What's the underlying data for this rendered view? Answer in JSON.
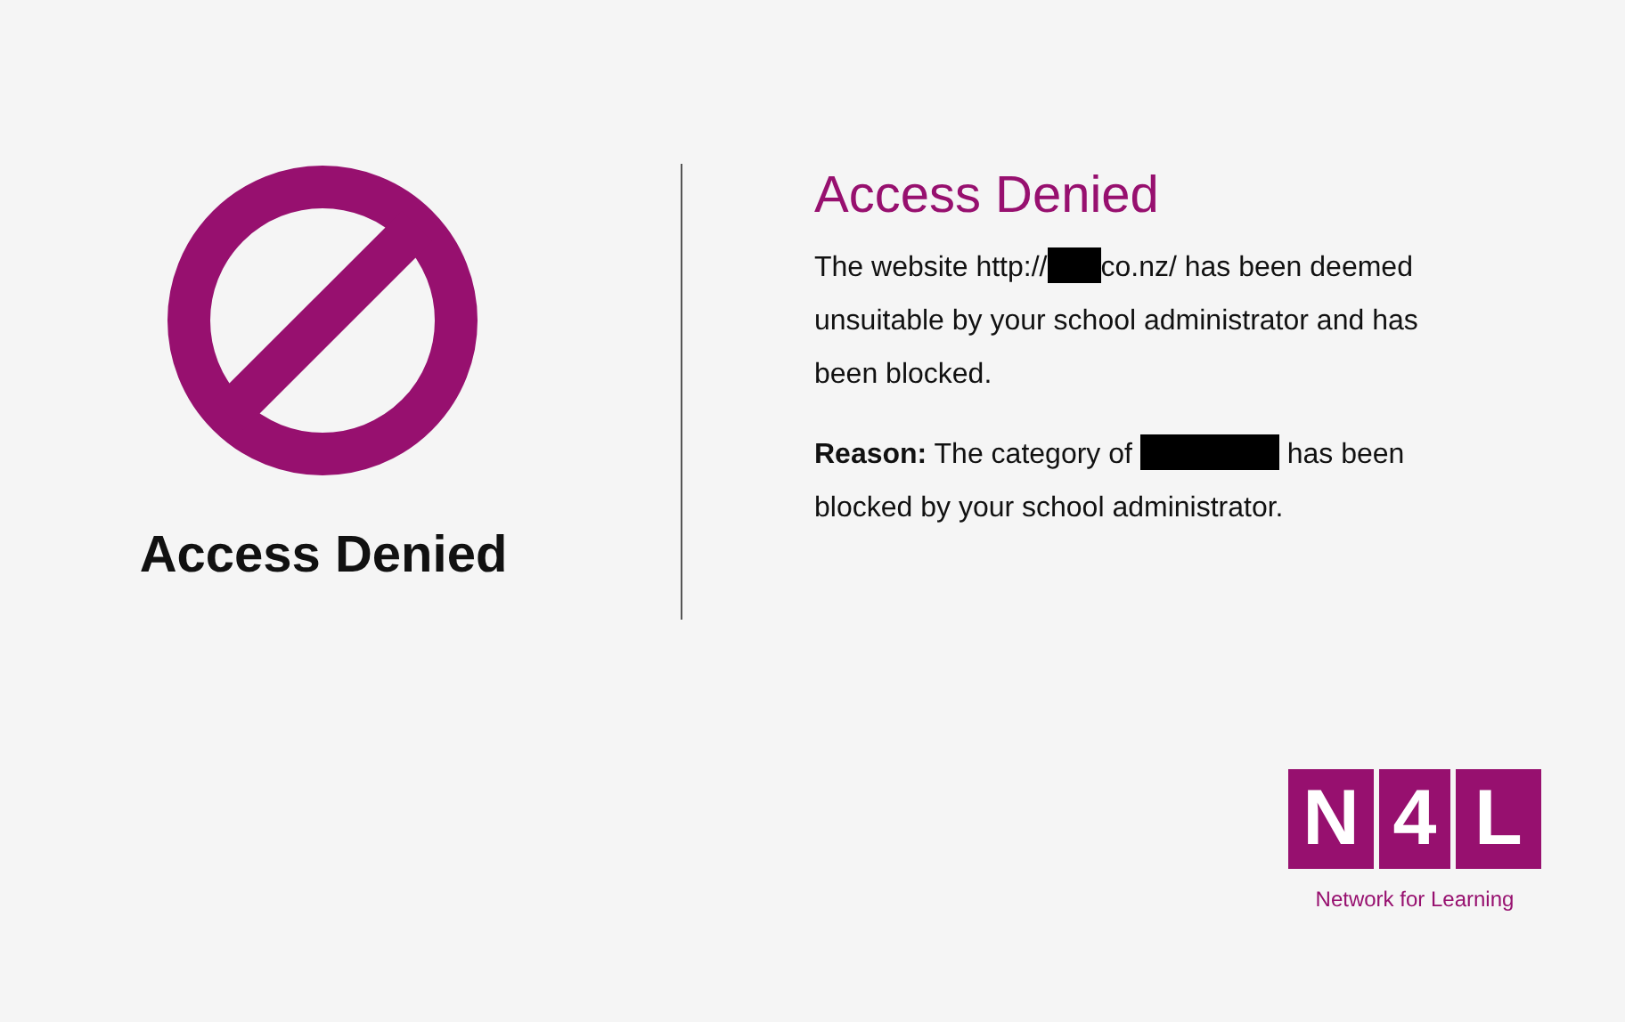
{
  "left": {
    "heading": "Access Denied"
  },
  "title": "Access Denied",
  "paragraphs": [
    {
      "parts": [
        {
          "kind": "text",
          "text": "The website http://"
        },
        {
          "kind": "redacted"
        },
        {
          "kind": "text",
          "text": "co.nz/ has been deemed unsuitable by your school administrator and has been blocked."
        }
      ]
    },
    {
      "parts": [
        {
          "kind": "bold",
          "text": "Reason:"
        },
        {
          "kind": "text",
          "text": " The category of "
        },
        {
          "kind": "redacted"
        },
        {
          "kind": "text",
          "text": " has been blocked by your school administrator."
        }
      ]
    }
  ],
  "logo": {
    "letters": [
      "N",
      "4",
      "L"
    ],
    "tagline": "Network for Learning"
  }
}
